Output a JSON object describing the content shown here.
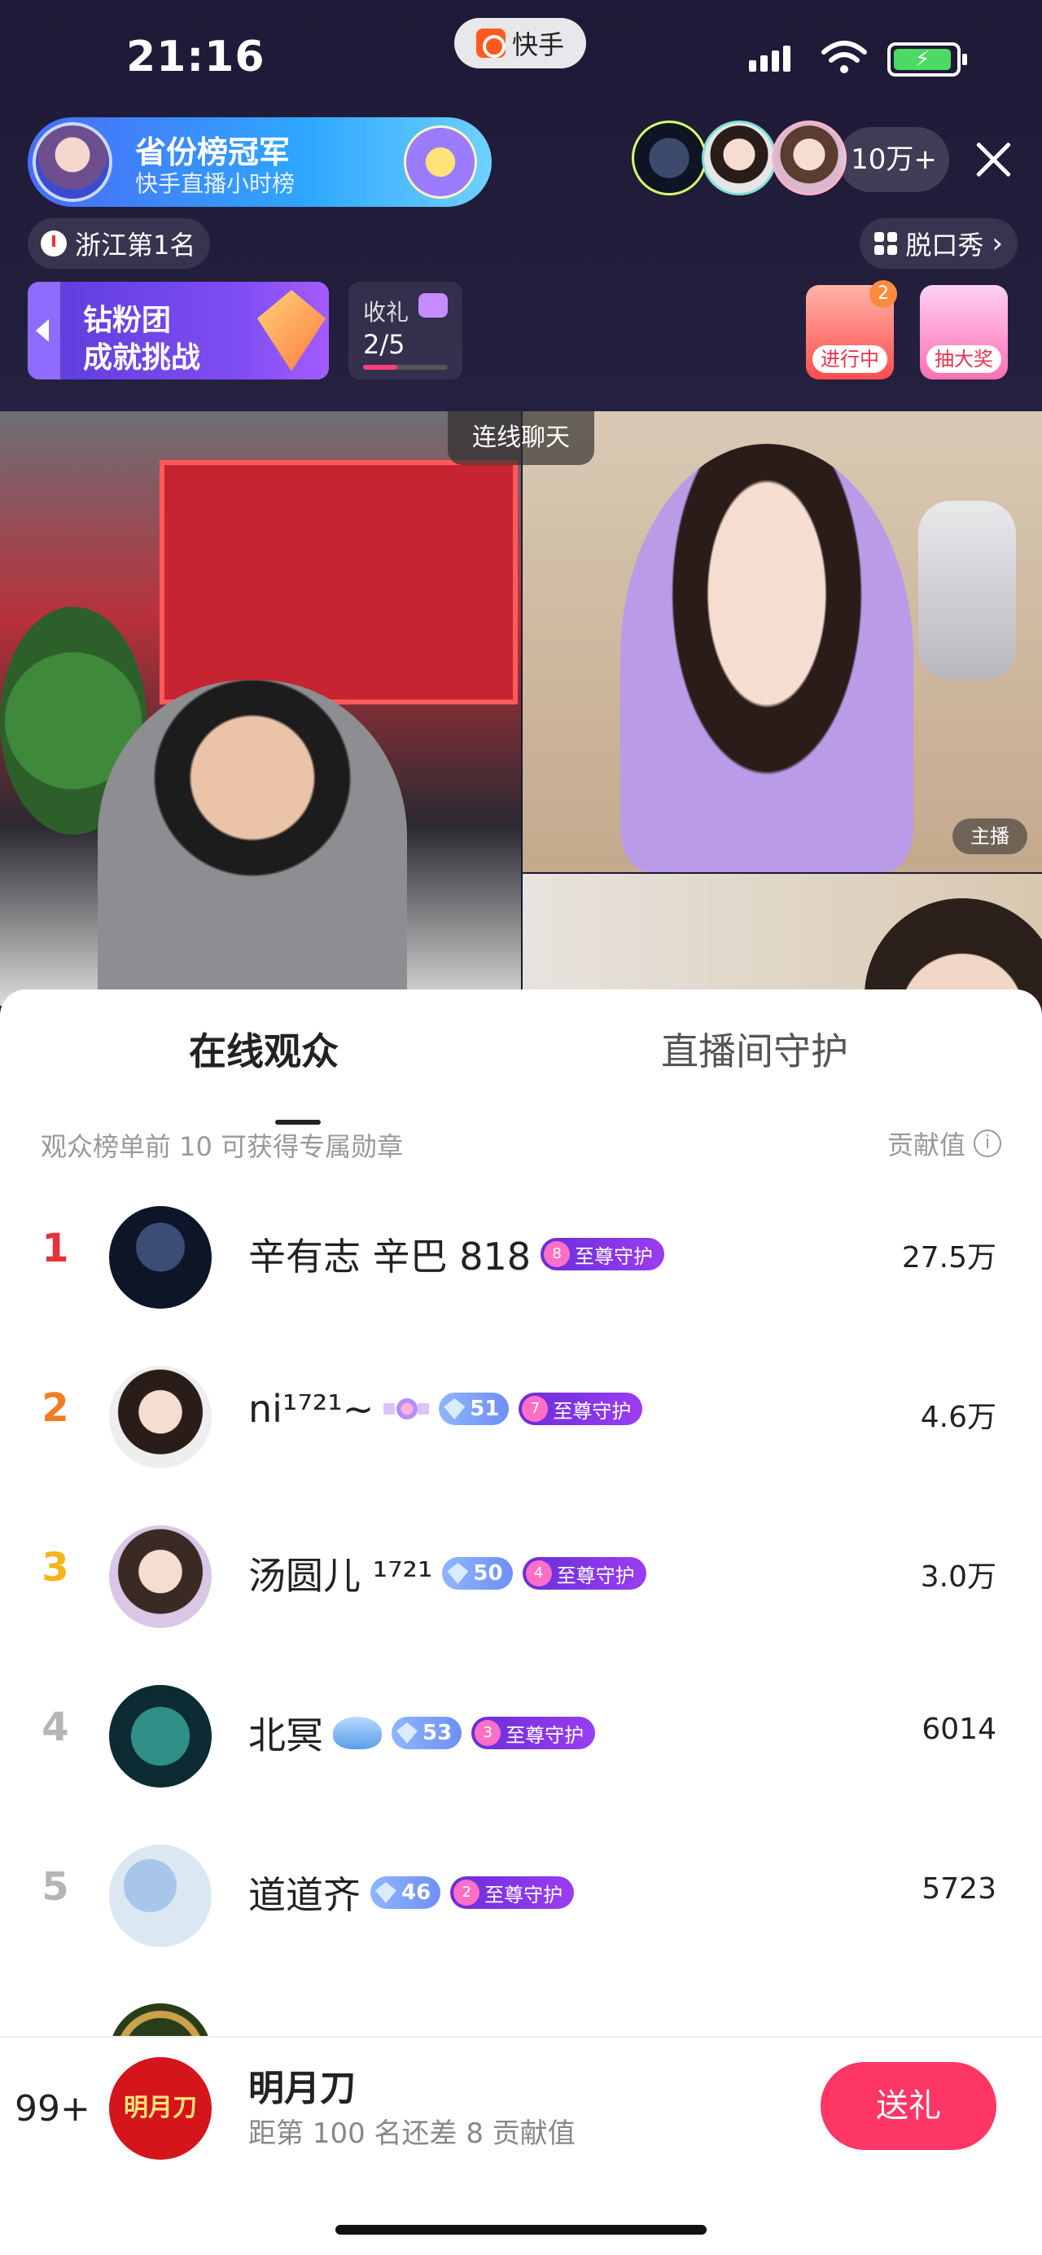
{
  "status": {
    "time": "21:16",
    "app": "快手"
  },
  "header": {
    "champion_title": "省份榜冠军",
    "champion_sub": "快手直播小时榜",
    "champion_avatar_tag": "",
    "viewer_count": "10万+",
    "rank_text": "浙江第1名",
    "category": "脱口秀",
    "fans_line1": "钻粉团",
    "fans_line2": "成就挑战",
    "gift_label": "收礼",
    "gift_progress": "2/5",
    "gift_progress_fraction": 0.4,
    "activity1_label": "进行中",
    "activity1_badge": "2",
    "activity2_label": "抽大奖"
  },
  "video": {
    "link_label": "连线聊天",
    "host_label": "主播"
  },
  "sheet": {
    "tab_online": "在线观众",
    "tab_guard": "直播间守护",
    "hint": "观众榜单前 10 可获得专属勋章",
    "contrib_label": "贡献值",
    "rows": [
      {
        "rank": "1",
        "name": "辛有志 辛巴 818",
        "level": "",
        "guard_num": "8",
        "guard": "至尊守护",
        "value": "27.5万",
        "rank_color": "#e8333a"
      },
      {
        "rank": "2",
        "name": "ni¹⁷²¹~",
        "level": "51",
        "guard_num": "7",
        "guard": "至尊守护",
        "value": "4.6万",
        "rank_color": "#f07c24"
      },
      {
        "rank": "3",
        "name": "汤圆儿 ¹⁷²¹",
        "level": "50",
        "guard_num": "4",
        "guard": "至尊守护",
        "value": "3.0万",
        "rank_color": "#f5b41a"
      },
      {
        "rank": "4",
        "name": "北冥",
        "level": "53",
        "guard_num": "3",
        "guard": "至尊守护",
        "value": "6014",
        "rank_color": "#b5b5b5"
      },
      {
        "rank": "5",
        "name": "道道齐",
        "level": "46",
        "guard_num": "2",
        "guard": "至尊守护",
        "value": "5723",
        "rank_color": "#b5b5b5"
      }
    ]
  },
  "me": {
    "rank": "99+",
    "avatar_text": "明月刀",
    "name": "明月刀",
    "sub": "距第 100 名还差 8 贡献值",
    "send_label": "送礼"
  }
}
